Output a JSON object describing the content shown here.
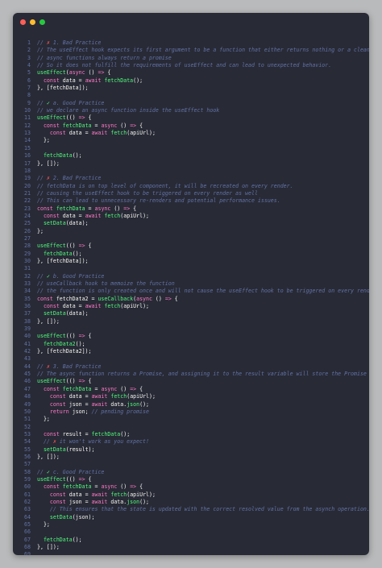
{
  "window": {
    "controls": [
      "close",
      "minimize",
      "maximize"
    ],
    "colors": {
      "background": "#282a36",
      "keyword": "#ff79c6",
      "function": "#50fa7b",
      "comment": "#6272a4",
      "text": "#f8f8f2"
    }
  },
  "lines": [
    {
      "n": "1",
      "tokens": [
        {
          "t": "// ",
          "c": "cm"
        },
        {
          "t": "✗",
          "c": "bp"
        },
        {
          "t": " 1. Bad Practice",
          "c": "cm"
        }
      ]
    },
    {
      "n": "2",
      "tokens": [
        {
          "t": "// The useEffect hook expects its first argument to be a function that either returns nothing or a cleanup function.",
          "c": "cm"
        }
      ]
    },
    {
      "n": "3",
      "tokens": [
        {
          "t": "// async functions always return a promise",
          "c": "cm"
        }
      ]
    },
    {
      "n": "4",
      "tokens": [
        {
          "t": "// So it does not fulfill the requirements of useEffect and can lead to unexpected behavior.",
          "c": "cm"
        }
      ]
    },
    {
      "n": "5",
      "tokens": [
        {
          "t": "useEffect",
          "c": "fn"
        },
        {
          "t": "(",
          "c": "pl"
        },
        {
          "t": "async",
          "c": "kw"
        },
        {
          "t": " () ",
          "c": "pl"
        },
        {
          "t": "=>",
          "c": "ar"
        },
        {
          "t": " {",
          "c": "pl"
        }
      ]
    },
    {
      "n": "6",
      "tokens": [
        {
          "t": "  ",
          "c": "pl"
        },
        {
          "t": "const",
          "c": "kw"
        },
        {
          "t": " data = ",
          "c": "pl"
        },
        {
          "t": "await",
          "c": "kw"
        },
        {
          "t": " ",
          "c": "pl"
        },
        {
          "t": "fetchData",
          "c": "fn"
        },
        {
          "t": "();",
          "c": "pl"
        }
      ]
    },
    {
      "n": "7",
      "tokens": [
        {
          "t": "}, [fetchData]);",
          "c": "pl"
        }
      ]
    },
    {
      "n": "8",
      "tokens": []
    },
    {
      "n": "9",
      "tokens": [
        {
          "t": "// ",
          "c": "cm"
        },
        {
          "t": "✓",
          "c": "gp"
        },
        {
          "t": " a. Good Practice",
          "c": "cm"
        }
      ]
    },
    {
      "n": "10",
      "tokens": [
        {
          "t": "// we declare an async function inside the useEffect hook",
          "c": "cm"
        }
      ]
    },
    {
      "n": "11",
      "tokens": [
        {
          "t": "useEffect",
          "c": "fn"
        },
        {
          "t": "(() ",
          "c": "pl"
        },
        {
          "t": "=>",
          "c": "ar"
        },
        {
          "t": " {",
          "c": "pl"
        }
      ]
    },
    {
      "n": "12",
      "tokens": [
        {
          "t": "  ",
          "c": "pl"
        },
        {
          "t": "const",
          "c": "kw"
        },
        {
          "t": " ",
          "c": "pl"
        },
        {
          "t": "fetchData",
          "c": "fn"
        },
        {
          "t": " = ",
          "c": "pl"
        },
        {
          "t": "async",
          "c": "kw"
        },
        {
          "t": " () ",
          "c": "pl"
        },
        {
          "t": "=>",
          "c": "ar"
        },
        {
          "t": " {",
          "c": "pl"
        }
      ]
    },
    {
      "n": "13",
      "tokens": [
        {
          "t": "    ",
          "c": "pl"
        },
        {
          "t": "const",
          "c": "kw"
        },
        {
          "t": " data = ",
          "c": "pl"
        },
        {
          "t": "await",
          "c": "kw"
        },
        {
          "t": " ",
          "c": "pl"
        },
        {
          "t": "fetch",
          "c": "fn"
        },
        {
          "t": "(apiUrl);",
          "c": "pl"
        }
      ]
    },
    {
      "n": "14",
      "tokens": [
        {
          "t": "  };",
          "c": "pl"
        }
      ]
    },
    {
      "n": "15",
      "tokens": []
    },
    {
      "n": "16",
      "tokens": [
        {
          "t": "  ",
          "c": "pl"
        },
        {
          "t": "fetchData",
          "c": "fn"
        },
        {
          "t": "();",
          "c": "pl"
        }
      ]
    },
    {
      "n": "17",
      "tokens": [
        {
          "t": "}, []);",
          "c": "pl"
        }
      ]
    },
    {
      "n": "18",
      "tokens": []
    },
    {
      "n": "19",
      "tokens": [
        {
          "t": "// ",
          "c": "cm"
        },
        {
          "t": "✗",
          "c": "bp"
        },
        {
          "t": " 2. Bad Practice",
          "c": "cm"
        }
      ]
    },
    {
      "n": "20",
      "tokens": [
        {
          "t": "// fetchData is on top level of component, it will be recreated on every render.",
          "c": "cm"
        }
      ]
    },
    {
      "n": "21",
      "tokens": [
        {
          "t": "// causing the useEffect hook to be triggered on every render as well",
          "c": "cm"
        }
      ]
    },
    {
      "n": "22",
      "tokens": [
        {
          "t": "// This can lead to unnecessary re-renders and potential performance issues.",
          "c": "cm"
        }
      ]
    },
    {
      "n": "23",
      "tokens": [
        {
          "t": "const",
          "c": "kw"
        },
        {
          "t": " ",
          "c": "pl"
        },
        {
          "t": "fetchData",
          "c": "fn"
        },
        {
          "t": " = ",
          "c": "pl"
        },
        {
          "t": "async",
          "c": "kw"
        },
        {
          "t": " () ",
          "c": "pl"
        },
        {
          "t": "=>",
          "c": "ar"
        },
        {
          "t": " {",
          "c": "pl"
        }
      ]
    },
    {
      "n": "24",
      "tokens": [
        {
          "t": "  ",
          "c": "pl"
        },
        {
          "t": "const",
          "c": "kw"
        },
        {
          "t": " data = ",
          "c": "pl"
        },
        {
          "t": "await",
          "c": "kw"
        },
        {
          "t": " ",
          "c": "pl"
        },
        {
          "t": "fetch",
          "c": "fn"
        },
        {
          "t": "(apiUrl);",
          "c": "pl"
        }
      ]
    },
    {
      "n": "25",
      "tokens": [
        {
          "t": "  ",
          "c": "pl"
        },
        {
          "t": "setData",
          "c": "fn"
        },
        {
          "t": "(data);",
          "c": "pl"
        }
      ]
    },
    {
      "n": "26",
      "tokens": [
        {
          "t": "};",
          "c": "pl"
        }
      ]
    },
    {
      "n": "27",
      "tokens": []
    },
    {
      "n": "28",
      "tokens": [
        {
          "t": "useEffect",
          "c": "fn"
        },
        {
          "t": "(() ",
          "c": "pl"
        },
        {
          "t": "=>",
          "c": "ar"
        },
        {
          "t": " {",
          "c": "pl"
        }
      ]
    },
    {
      "n": "29",
      "tokens": [
        {
          "t": "  ",
          "c": "pl"
        },
        {
          "t": "fetchData",
          "c": "fn"
        },
        {
          "t": "();",
          "c": "pl"
        }
      ]
    },
    {
      "n": "30",
      "tokens": [
        {
          "t": "}, [fetchData]);",
          "c": "pl"
        }
      ]
    },
    {
      "n": "31",
      "tokens": []
    },
    {
      "n": "32",
      "tokens": [
        {
          "t": "// ",
          "c": "cm"
        },
        {
          "t": "✓",
          "c": "gp"
        },
        {
          "t": " b. Good Practice",
          "c": "cm"
        }
      ]
    },
    {
      "n": "33",
      "tokens": [
        {
          "t": "// useCallback hook to memoize the function",
          "c": "cm"
        }
      ]
    },
    {
      "n": "34",
      "tokens": [
        {
          "t": "// the function is only created once and will not cause the useEffect hook to be triggered on every render",
          "c": "cm"
        }
      ]
    },
    {
      "n": "35",
      "tokens": [
        {
          "t": "const",
          "c": "kw"
        },
        {
          "t": " fetchData2 = ",
          "c": "pl"
        },
        {
          "t": "useCallback",
          "c": "fn"
        },
        {
          "t": "(",
          "c": "pl"
        },
        {
          "t": "async",
          "c": "kw"
        },
        {
          "t": " () ",
          "c": "pl"
        },
        {
          "t": "=>",
          "c": "ar"
        },
        {
          "t": " {",
          "c": "pl"
        }
      ]
    },
    {
      "n": "36",
      "tokens": [
        {
          "t": "  ",
          "c": "pl"
        },
        {
          "t": "const",
          "c": "kw"
        },
        {
          "t": " data = ",
          "c": "pl"
        },
        {
          "t": "await",
          "c": "kw"
        },
        {
          "t": " ",
          "c": "pl"
        },
        {
          "t": "fetch",
          "c": "fn"
        },
        {
          "t": "(apiUrl);",
          "c": "pl"
        }
      ]
    },
    {
      "n": "37",
      "tokens": [
        {
          "t": "  ",
          "c": "pl"
        },
        {
          "t": "setData",
          "c": "fn"
        },
        {
          "t": "(data);",
          "c": "pl"
        }
      ]
    },
    {
      "n": "38",
      "tokens": [
        {
          "t": "}, []);",
          "c": "pl"
        }
      ]
    },
    {
      "n": "39",
      "tokens": []
    },
    {
      "n": "40",
      "tokens": [
        {
          "t": "useEffect",
          "c": "fn"
        },
        {
          "t": "(() ",
          "c": "pl"
        },
        {
          "t": "=>",
          "c": "ar"
        },
        {
          "t": " {",
          "c": "pl"
        }
      ]
    },
    {
      "n": "41",
      "tokens": [
        {
          "t": "  ",
          "c": "pl"
        },
        {
          "t": "fetchData2",
          "c": "fn"
        },
        {
          "t": "();",
          "c": "pl"
        }
      ]
    },
    {
      "n": "42",
      "tokens": [
        {
          "t": "}, [fetchData2]);",
          "c": "pl"
        }
      ]
    },
    {
      "n": "43",
      "tokens": []
    },
    {
      "n": "44",
      "tokens": [
        {
          "t": "// ",
          "c": "cm"
        },
        {
          "t": "✗",
          "c": "bp"
        },
        {
          "t": " 3. Bad Practice",
          "c": "cm"
        }
      ]
    },
    {
      "n": "45",
      "tokens": [
        {
          "t": "// The async function returns a Promise, and assigning it to the result variable will store the Promise",
          "c": "cm"
        }
      ]
    },
    {
      "n": "46",
      "tokens": [
        {
          "t": "useEffect",
          "c": "fn"
        },
        {
          "t": "(() ",
          "c": "pl"
        },
        {
          "t": "=>",
          "c": "ar"
        },
        {
          "t": " {",
          "c": "pl"
        }
      ]
    },
    {
      "n": "47",
      "tokens": [
        {
          "t": "  ",
          "c": "pl"
        },
        {
          "t": "const",
          "c": "kw"
        },
        {
          "t": " ",
          "c": "pl"
        },
        {
          "t": "fetchData",
          "c": "fn"
        },
        {
          "t": " = ",
          "c": "pl"
        },
        {
          "t": "async",
          "c": "kw"
        },
        {
          "t": " () ",
          "c": "pl"
        },
        {
          "t": "=>",
          "c": "ar"
        },
        {
          "t": " {",
          "c": "pl"
        }
      ]
    },
    {
      "n": "48",
      "tokens": [
        {
          "t": "    ",
          "c": "pl"
        },
        {
          "t": "const",
          "c": "kw"
        },
        {
          "t": " data = ",
          "c": "pl"
        },
        {
          "t": "await",
          "c": "kw"
        },
        {
          "t": " ",
          "c": "pl"
        },
        {
          "t": "fetch",
          "c": "fn"
        },
        {
          "t": "(apiUrl);",
          "c": "pl"
        }
      ]
    },
    {
      "n": "49",
      "tokens": [
        {
          "t": "    ",
          "c": "pl"
        },
        {
          "t": "const",
          "c": "kw"
        },
        {
          "t": " json = ",
          "c": "pl"
        },
        {
          "t": "await",
          "c": "kw"
        },
        {
          "t": " data.",
          "c": "pl"
        },
        {
          "t": "json",
          "c": "fn"
        },
        {
          "t": "();",
          "c": "pl"
        }
      ]
    },
    {
      "n": "50",
      "tokens": [
        {
          "t": "    ",
          "c": "pl"
        },
        {
          "t": "return",
          "c": "kw"
        },
        {
          "t": " json; ",
          "c": "pl"
        },
        {
          "t": "// pending promise",
          "c": "cm"
        }
      ]
    },
    {
      "n": "51",
      "tokens": [
        {
          "t": "  };",
          "c": "pl"
        }
      ]
    },
    {
      "n": "52",
      "tokens": []
    },
    {
      "n": "53",
      "tokens": [
        {
          "t": "  ",
          "c": "pl"
        },
        {
          "t": "const",
          "c": "kw"
        },
        {
          "t": " result = ",
          "c": "pl"
        },
        {
          "t": "fetchData",
          "c": "fn"
        },
        {
          "t": "();",
          "c": "pl"
        }
      ]
    },
    {
      "n": "54",
      "tokens": [
        {
          "t": "  // ",
          "c": "cm"
        },
        {
          "t": "✗",
          "c": "bp"
        },
        {
          "t": " it won't work as you expect!",
          "c": "cm"
        }
      ]
    },
    {
      "n": "55",
      "tokens": [
        {
          "t": "  ",
          "c": "pl"
        },
        {
          "t": "setData",
          "c": "fn"
        },
        {
          "t": "(result);",
          "c": "pl"
        }
      ]
    },
    {
      "n": "56",
      "tokens": [
        {
          "t": "}, []);",
          "c": "pl"
        }
      ]
    },
    {
      "n": "57",
      "tokens": []
    },
    {
      "n": "58",
      "tokens": [
        {
          "t": "// ",
          "c": "cm"
        },
        {
          "t": "✓",
          "c": "gp"
        },
        {
          "t": " c. Good Practice",
          "c": "cm"
        }
      ]
    },
    {
      "n": "59",
      "tokens": [
        {
          "t": "useEffect",
          "c": "fn"
        },
        {
          "t": "(() ",
          "c": "pl"
        },
        {
          "t": "=>",
          "c": "ar"
        },
        {
          "t": " {",
          "c": "pl"
        }
      ]
    },
    {
      "n": "60",
      "tokens": [
        {
          "t": "  ",
          "c": "pl"
        },
        {
          "t": "const",
          "c": "kw"
        },
        {
          "t": " ",
          "c": "pl"
        },
        {
          "t": "fetchData",
          "c": "fn"
        },
        {
          "t": " = ",
          "c": "pl"
        },
        {
          "t": "async",
          "c": "kw"
        },
        {
          "t": " () ",
          "c": "pl"
        },
        {
          "t": "=>",
          "c": "ar"
        },
        {
          "t": " {",
          "c": "pl"
        }
      ]
    },
    {
      "n": "61",
      "tokens": [
        {
          "t": "    ",
          "c": "pl"
        },
        {
          "t": "const",
          "c": "kw"
        },
        {
          "t": " data = ",
          "c": "pl"
        },
        {
          "t": "await",
          "c": "kw"
        },
        {
          "t": " ",
          "c": "pl"
        },
        {
          "t": "fetch",
          "c": "fn"
        },
        {
          "t": "(apiUrl);",
          "c": "pl"
        }
      ]
    },
    {
      "n": "62",
      "tokens": [
        {
          "t": "    ",
          "c": "pl"
        },
        {
          "t": "const",
          "c": "kw"
        },
        {
          "t": " json = ",
          "c": "pl"
        },
        {
          "t": "await",
          "c": "kw"
        },
        {
          "t": " data.",
          "c": "pl"
        },
        {
          "t": "json",
          "c": "fn"
        },
        {
          "t": "();",
          "c": "pl"
        }
      ]
    },
    {
      "n": "63",
      "tokens": [
        {
          "t": "    // This ensures that the state is updated with the correct resolved value from the asynch operation.",
          "c": "cm"
        }
      ]
    },
    {
      "n": "64",
      "tokens": [
        {
          "t": "    ",
          "c": "pl"
        },
        {
          "t": "setData",
          "c": "fn"
        },
        {
          "t": "(json);",
          "c": "pl"
        }
      ]
    },
    {
      "n": "65",
      "tokens": [
        {
          "t": "  };",
          "c": "pl"
        }
      ]
    },
    {
      "n": "66",
      "tokens": []
    },
    {
      "n": "67",
      "tokens": [
        {
          "t": "  ",
          "c": "pl"
        },
        {
          "t": "fetchData",
          "c": "fn"
        },
        {
          "t": "();",
          "c": "pl"
        }
      ]
    },
    {
      "n": "68",
      "tokens": [
        {
          "t": "}, []);",
          "c": "pl"
        }
      ]
    },
    {
      "n": "69",
      "tokens": []
    }
  ]
}
